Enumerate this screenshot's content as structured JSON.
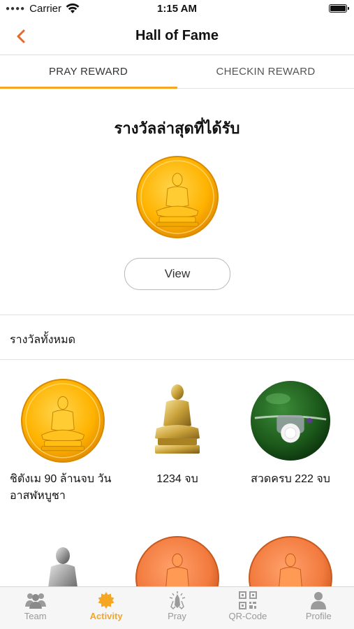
{
  "status": {
    "carrier": "Carrier",
    "time": "1:15 AM"
  },
  "nav": {
    "title": "Hall of Fame"
  },
  "tabs": [
    {
      "label": "PRAY REWARD",
      "active": true
    },
    {
      "label": "CHECKIN REWARD",
      "active": false
    }
  ],
  "latest": {
    "title": "รางวัลล่าสุดที่ได้รับ",
    "view_label": "View"
  },
  "all": {
    "title": "รางวัลทั้งหมด"
  },
  "rewards": [
    {
      "label": "ชิตังเม 90 ล้านจบ วันอาสฬหบูชา",
      "icon": "gold-buddha-medal"
    },
    {
      "label": "1234 จบ",
      "icon": "gold-monk-statue"
    },
    {
      "label": "สวดครบ 222 จบ",
      "icon": "green-amulet"
    },
    {
      "label": "",
      "icon": "silver-monk-statue"
    },
    {
      "label": "",
      "icon": "orange-buddha-medal"
    },
    {
      "label": "",
      "icon": "orange-buddha-medal"
    }
  ],
  "tab_bar": [
    {
      "label": "Team",
      "icon": "team-icon",
      "active": false
    },
    {
      "label": "Activity",
      "icon": "activity-icon",
      "active": true
    },
    {
      "label": "Pray",
      "icon": "pray-icon",
      "active": false
    },
    {
      "label": "QR-Code",
      "icon": "qr-code-icon",
      "active": false
    },
    {
      "label": "Profile",
      "icon": "profile-icon",
      "active": false
    }
  ],
  "colors": {
    "accent": "#f5a623",
    "back_arrow": "#e8672a",
    "inactive": "#999999"
  }
}
